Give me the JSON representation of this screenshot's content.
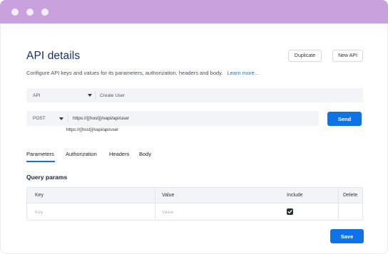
{
  "window": {
    "controls": [
      "window-dot-1",
      "window-dot-2",
      "window-dot-3"
    ]
  },
  "header": {
    "title": "API details",
    "duplicate_label": "Duplicate",
    "new_api_label": "New API"
  },
  "description": {
    "text": "Configure API keys and values for its parameters, authorization, headers and body.",
    "link": "Learn more..."
  },
  "api_row": {
    "selected": "API",
    "name": "Create User"
  },
  "request_row": {
    "method": "POST",
    "url": "https://{{host}}/vapi/api/user",
    "resolved_url": "https://{{host}}/vapi/api/user",
    "send_label": "Send"
  },
  "tabs": [
    {
      "label": "Parameters",
      "active": true
    },
    {
      "label": "Authorization",
      "active": false
    },
    {
      "label": "Headers",
      "active": false
    },
    {
      "label": "Body",
      "active": false
    }
  ],
  "query_params": {
    "title": "Query params",
    "columns": [
      "Key",
      "Value",
      "Include",
      "Delete"
    ],
    "rows": [
      {
        "key_placeholder": "Key",
        "value_placeholder": "Value",
        "include": true
      }
    ]
  },
  "footer": {
    "save_label": "Save"
  },
  "colors": {
    "accent": "#0d73e6",
    "titlebar": "#c9a2dd",
    "title": "#1b2d6b"
  }
}
